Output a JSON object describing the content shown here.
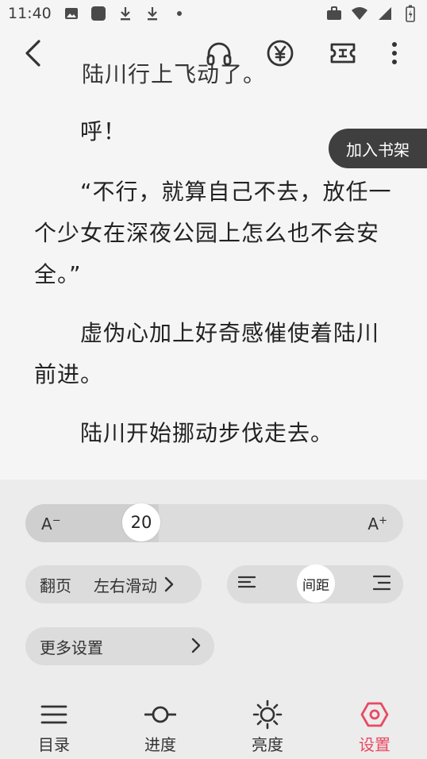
{
  "status_bar": {
    "time": "11:40",
    "icons_left": [
      "image-icon",
      "app-square-icon",
      "download-icon",
      "download-icon",
      "dot-icon"
    ],
    "icons_right": [
      "briefcase-icon",
      "wifi-icon",
      "signal-icon",
      "battery-icon"
    ]
  },
  "toolbar": {
    "back_icon": "back-arrow-icon",
    "actions": [
      "headphones-icon",
      "yuan-coin-icon",
      "ticket-icon",
      "more-vertical-icon"
    ]
  },
  "content": {
    "paragraphs": [
      "陆川行上飞动了。",
      "　　呼！",
      "　　“不行，就算自己不去，放任一个少女在深夜公园上怎么也不会安全。”",
      "　　虚伪心加上好奇感催使着陆川前进。",
      "　　陆川开始挪动步伐走去。"
    ],
    "add_to_shelf": "加入书架"
  },
  "settings": {
    "font_decrease": "A",
    "font_decrease_sup": "−",
    "font_size": "20",
    "font_increase": "A",
    "font_increase_sup": "+",
    "page_turn_label": "翻页",
    "page_turn_value": "左右滑动",
    "spacing_label": "间距",
    "more_settings": "更多设置"
  },
  "nav": {
    "items": [
      {
        "label": "目录",
        "icon": "menu-icon"
      },
      {
        "label": "进度",
        "icon": "progress-icon"
      },
      {
        "label": "亮度",
        "icon": "brightness-icon"
      },
      {
        "label": "设置",
        "icon": "settings-icon"
      }
    ],
    "active_index": 3,
    "active_color": "#e84a63"
  }
}
